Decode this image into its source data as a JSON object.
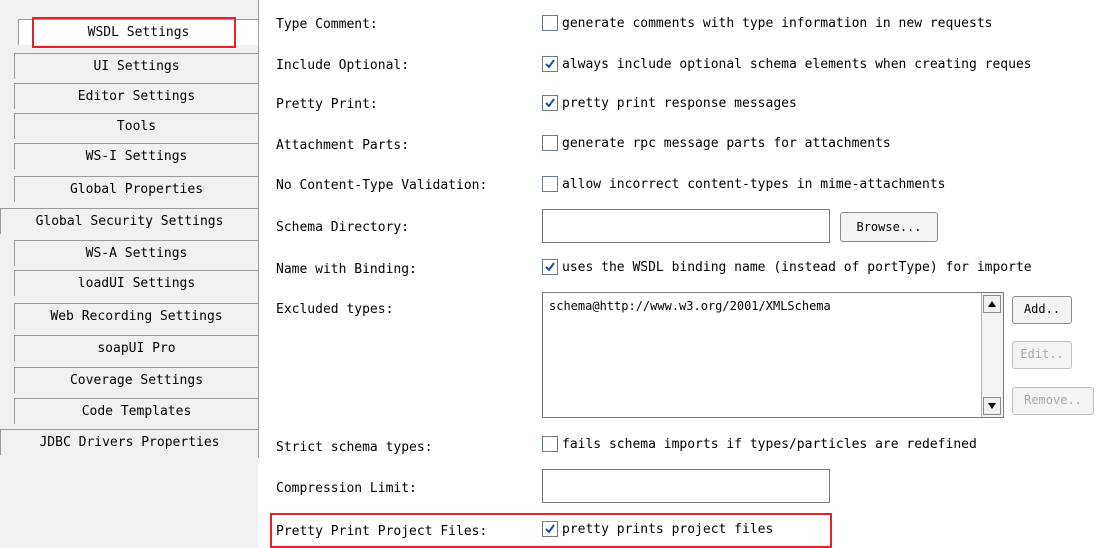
{
  "tabs": [
    {
      "label": "WSDL Settings",
      "selected": true
    },
    {
      "label": "UI Settings"
    },
    {
      "label": "Editor Settings"
    },
    {
      "label": "Tools"
    },
    {
      "label": "WS-I Settings"
    },
    {
      "label": "Global Properties"
    },
    {
      "label": "Global Security Settings"
    },
    {
      "label": "WS-A Settings"
    },
    {
      "label": "loadUI Settings"
    },
    {
      "label": "Web Recording Settings"
    },
    {
      "label": "soapUI Pro"
    },
    {
      "label": "Coverage Settings"
    },
    {
      "label": "Code Templates"
    },
    {
      "label": "JDBC Drivers Properties"
    }
  ],
  "settings": {
    "type_comment": {
      "label": "Type Comment:",
      "checked": false,
      "text": "generate comments with type information in new requests"
    },
    "include_optional": {
      "label": "Include Optional:",
      "checked": true,
      "text": "always include optional schema elements when creating reques"
    },
    "pretty_print": {
      "label": "Pretty Print:",
      "checked": true,
      "text": "pretty print response messages"
    },
    "attachment_parts": {
      "label": "Attachment Parts:",
      "checked": false,
      "text": "generate rpc message parts for attachments"
    },
    "no_content_type": {
      "label": "No Content-Type Validation:",
      "checked": false,
      "text": "allow incorrect content-types in mime-attachments"
    },
    "schema_directory": {
      "label": "Schema Directory:",
      "value": "",
      "browse_label": "Browse..."
    },
    "name_with_binding": {
      "label": "Name with Binding:",
      "checked": true,
      "text": "uses the WSDL binding name (instead of portType) for importe"
    },
    "excluded_types": {
      "label": "Excluded types:",
      "items": [
        "schema@http://www.w3.org/2001/XMLSchema"
      ],
      "add_label": "Add..",
      "edit_label": "Edit..",
      "remove_label": "Remove.."
    },
    "strict_schema": {
      "label": "Strict schema types:",
      "checked": false,
      "text": "fails schema imports if types/particles are redefined"
    },
    "compression_limit": {
      "label": "Compression Limit:",
      "value": ""
    },
    "pretty_print_project": {
      "label": "Pretty Print Project Files:",
      "checked": true,
      "text": "pretty prints project files"
    }
  },
  "colors": {
    "highlight": "#e8202a",
    "check": "#1c4fa0"
  }
}
